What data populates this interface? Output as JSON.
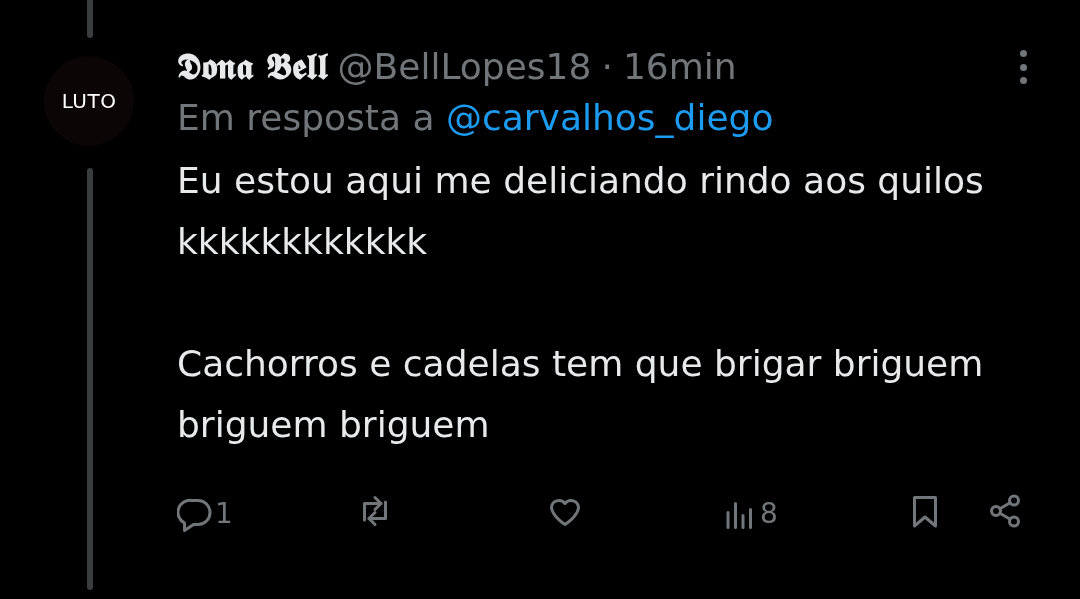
{
  "tweet": {
    "avatar_text": "LUTO",
    "display_name": "𝕯𝖔𝖓𝖆 𝕭𝖊𝖑𝖑",
    "handle": "@BellLopes18",
    "separator": "·",
    "time": "16min",
    "reply_prefix": "Em resposta a",
    "reply_to": "@carvalhos_diego",
    "paragraphs": [
      "Eu estou aqui me deliciando rindo aos quilos kkkkkkkkkkkk",
      "Cachorros e cadelas tem que brigar briguem briguem briguem"
    ],
    "actions": [
      {
        "kind": "reply",
        "count": "1"
      },
      {
        "kind": "retweet"
      },
      {
        "kind": "like"
      },
      {
        "kind": "views",
        "count": "8"
      },
      {
        "kind": "bookmark"
      },
      {
        "kind": "share"
      }
    ]
  }
}
